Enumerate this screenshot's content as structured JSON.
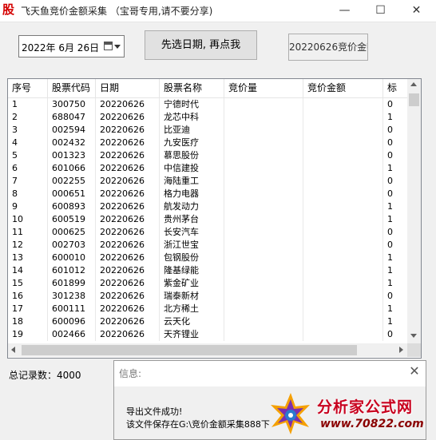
{
  "window": {
    "icon_glyph": "股",
    "title": "飞天鱼竞价金额采集 （宝哥专用,请不要分享)",
    "minimize_glyph": "—",
    "maximize_glyph": "☐",
    "close_glyph": "✕"
  },
  "toolbar": {
    "date_value": "2022年  6月 26日",
    "select_button_label": "先选日期, 再点我",
    "export_button_label": "20220626竞价金额"
  },
  "table": {
    "columns": [
      "序号",
      "股票代码",
      "日期",
      "股票名称",
      "竞价量",
      "竞价金额",
      "标"
    ],
    "rows": [
      [
        "1",
        "300750",
        "20220626",
        "宁德时代",
        "",
        "",
        "0"
      ],
      [
        "2",
        "688047",
        "20220626",
        "龙芯中科",
        "",
        "",
        "1"
      ],
      [
        "3",
        "002594",
        "20220626",
        "比亚迪",
        "",
        "",
        "0"
      ],
      [
        "4",
        "002432",
        "20220626",
        "九安医疗",
        "",
        "",
        "0"
      ],
      [
        "5",
        "001323",
        "20220626",
        "慕思股份",
        "",
        "",
        "0"
      ],
      [
        "6",
        "601066",
        "20220626",
        "中信建投",
        "",
        "",
        "1"
      ],
      [
        "7",
        "002255",
        "20220626",
        "海陆重工",
        "",
        "",
        "0"
      ],
      [
        "8",
        "000651",
        "20220626",
        "格力电器",
        "",
        "",
        "0"
      ],
      [
        "9",
        "600893",
        "20220626",
        "航发动力",
        "",
        "",
        "1"
      ],
      [
        "10",
        "600519",
        "20220626",
        "贵州茅台",
        "",
        "",
        "1"
      ],
      [
        "11",
        "000625",
        "20220626",
        "长安汽车",
        "",
        "",
        "0"
      ],
      [
        "12",
        "002703",
        "20220626",
        "浙江世宝",
        "",
        "",
        "0"
      ],
      [
        "13",
        "600010",
        "20220626",
        "包钢股份",
        "",
        "",
        "1"
      ],
      [
        "14",
        "601012",
        "20220626",
        "隆基绿能",
        "",
        "",
        "1"
      ],
      [
        "15",
        "601899",
        "20220626",
        "紫金矿业",
        "",
        "",
        "1"
      ],
      [
        "16",
        "301238",
        "20220626",
        "瑞泰新材",
        "",
        "",
        "0"
      ],
      [
        "17",
        "600111",
        "20220626",
        "北方稀土",
        "",
        "",
        "1"
      ],
      [
        "18",
        "600096",
        "20220626",
        "云天化",
        "",
        "",
        "1"
      ],
      [
        "19",
        "002466",
        "20220626",
        "天齐锂业",
        "",
        "",
        "0"
      ]
    ]
  },
  "status": {
    "total_label": "总记录数：4000"
  },
  "message_box": {
    "title": "信息:",
    "close_glyph": "✕",
    "line1": "导出文件成功!",
    "line2": "该文件保存在G:\\竞价金额采集888下"
  },
  "watermark": {
    "title": "分析家公式网",
    "url": "www.70822.com"
  },
  "colors": {
    "brand_red": "#d40000",
    "watermark_red": "#c8001e"
  }
}
